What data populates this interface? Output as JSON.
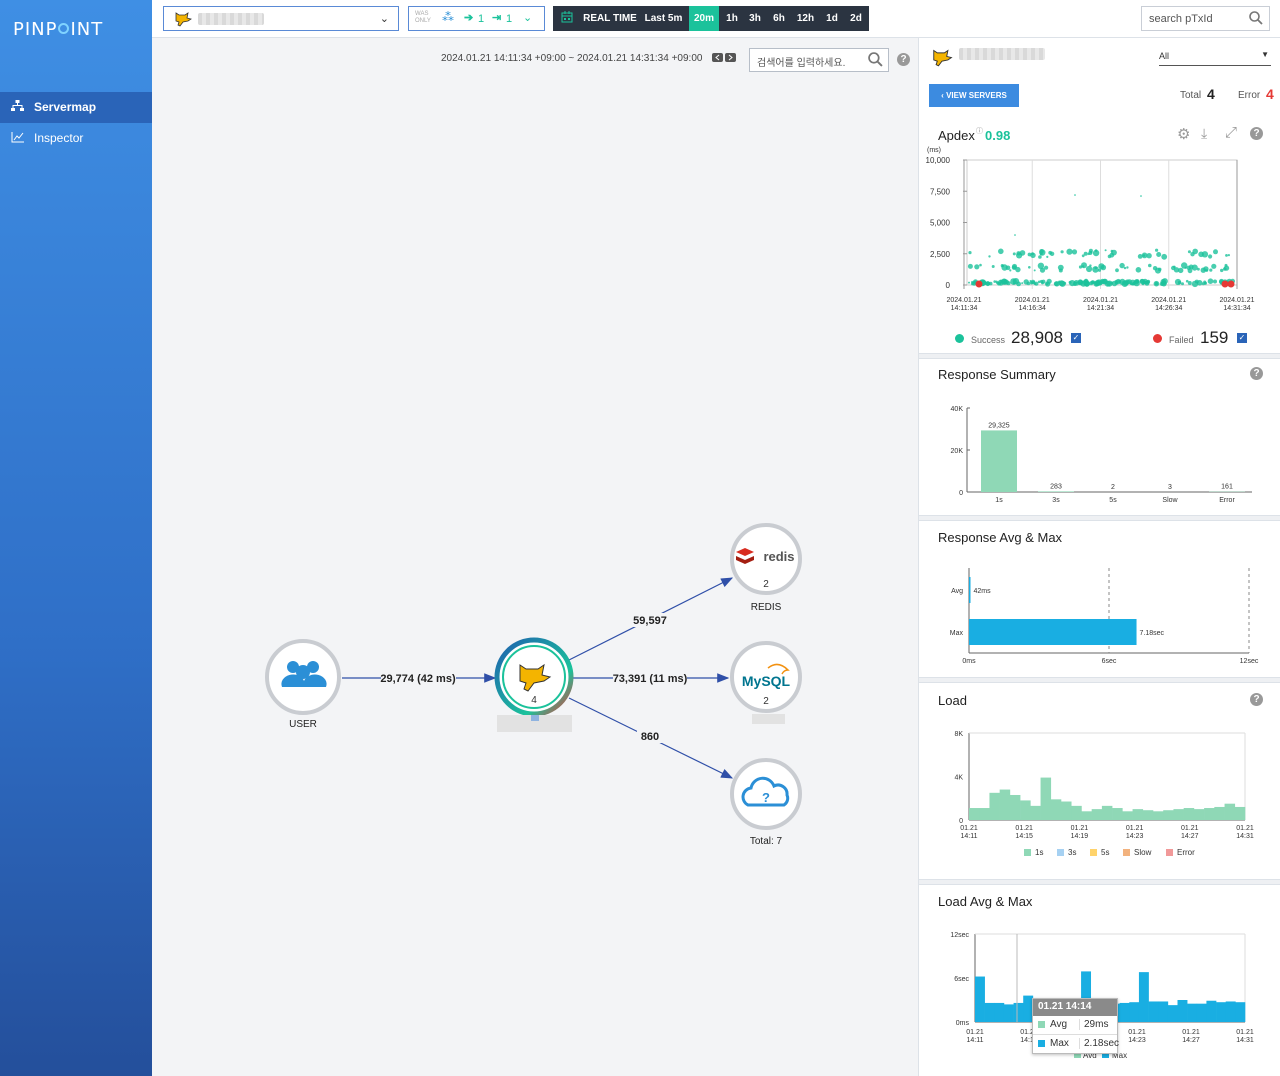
{
  "sidebar": {
    "logo": "PINPOINT",
    "items": [
      {
        "label": "Servermap",
        "icon": "servermap-icon"
      },
      {
        "label": "Inspector",
        "icon": "chart-icon"
      }
    ]
  },
  "topbar": {
    "filter": {
      "was_label": "WAS ONLY",
      "inbound": "1",
      "outbound": "1"
    },
    "time_buttons": [
      "REAL TIME",
      "Last 5m",
      "20m",
      "1h",
      "3h",
      "6h",
      "12h",
      "1d",
      "2d"
    ],
    "active_time": "20m",
    "search_placeholder": "search pTxId"
  },
  "servermap": {
    "range": "2024.01.21 14:11:34 +09:00 ~ 2024.01.21 14:31:34 +09:00",
    "search_placeholder": "검색어를 입력하세요.",
    "nodes": {
      "user": {
        "label": "USER"
      },
      "app": {
        "count": "4"
      },
      "redis": {
        "label": "REDIS",
        "count": "2",
        "logo": "redis"
      },
      "mysql": {
        "count": "2",
        "logo": "MySQL"
      },
      "unknown": {
        "label": "Total: 7"
      }
    },
    "edges": {
      "user_app": "29,774 (42 ms)",
      "app_redis": "59,597",
      "app_mysql": "73,391 (11 ms)",
      "app_unknown": "860"
    }
  },
  "panel": {
    "agent_filter": "All",
    "view_servers": "VIEW SERVERS",
    "total_label": "Total",
    "total": "4",
    "error_label": "Error",
    "error": "4",
    "apdex_label": "Apdex",
    "apdex": "0.98",
    "scatter": {
      "unit": "(ms)",
      "y_ticks": [
        "10,000",
        "7,500",
        "5,000",
        "2,500",
        "0"
      ],
      "x_ticks": [
        [
          "2024.01.21",
          "14:11:34"
        ],
        [
          "2024.01.21",
          "14:16:34"
        ],
        [
          "2024.01.21",
          "14:21:34"
        ],
        [
          "2024.01.21",
          "14:26:34"
        ],
        [
          "2024.01.21",
          "14:31:34"
        ]
      ],
      "success_label": "Success",
      "success": "28,908",
      "failed_label": "Failed",
      "failed": "159",
      "success_color": "#1bc29b",
      "failed_color": "#e53935"
    },
    "response_summary": {
      "title": "Response Summary"
    },
    "response_avg_max": {
      "title": "Response Avg & Max"
    },
    "load": {
      "title": "Load",
      "legend": [
        "1s",
        "3s",
        "5s",
        "Slow",
        "Error"
      ]
    },
    "load_avg_max": {
      "title": "Load Avg & Max",
      "tooltip": {
        "time": "01.21 14:14",
        "avg_label": "Avg",
        "avg": "29ms",
        "max_label": "Max",
        "max": "2.18sec"
      },
      "legend": [
        "Avg",
        "Max"
      ]
    }
  },
  "chart_data": [
    {
      "type": "bar",
      "title": "Response Summary",
      "categories": [
        "1s",
        "3s",
        "5s",
        "Slow",
        "Error"
      ],
      "values": [
        29325,
        283,
        2,
        3,
        161
      ],
      "y_ticks": [
        "40K",
        "20K",
        "0"
      ],
      "ylim": [
        0,
        40000
      ],
      "color": "#8fd8b6"
    },
    {
      "type": "bar",
      "title": "Response Avg & Max",
      "orientation": "horizontal",
      "categories": [
        "Avg",
        "Max"
      ],
      "values_ms": [
        42,
        7180
      ],
      "labels": [
        "42ms",
        "7.18sec"
      ],
      "x_ticks": [
        "0ms",
        "6sec",
        "12sec"
      ],
      "xlim": [
        0,
        12000
      ],
      "color": "#19aee2"
    },
    {
      "type": "bar",
      "title": "Load",
      "y_ticks": [
        "8K",
        "4K",
        "0"
      ],
      "ylim": [
        0,
        8000
      ],
      "x_ticks": [
        [
          "01.21",
          "14:11"
        ],
        [
          "01.21",
          "14:15"
        ],
        [
          "01.21",
          "14:19"
        ],
        [
          "01.21",
          "14:23"
        ],
        [
          "01.21",
          "14:27"
        ],
        [
          "01.21",
          "14:31"
        ]
      ],
      "series": [
        {
          "name": "1s",
          "color": "#8fd8b6"
        },
        {
          "name": "3s",
          "color": "#a6d1f2"
        },
        {
          "name": "5s",
          "color": "#ffd36b"
        },
        {
          "name": "Slow",
          "color": "#f2b27e"
        },
        {
          "name": "Error",
          "color": "#f19999"
        }
      ],
      "values": [
        1100,
        1100,
        2500,
        2800,
        2300,
        1800,
        1300,
        3900,
        1900,
        1700,
        1300,
        800,
        1000,
        1300,
        1100,
        800,
        1000,
        900,
        800,
        900,
        1000,
        1100,
        1000,
        1100,
        1200,
        1500,
        1200
      ]
    },
    {
      "type": "bar",
      "title": "Load Avg & Max",
      "y_ticks": [
        "12sec",
        "6sec",
        "0ms"
      ],
      "ylim": [
        0,
        12000
      ],
      "x_ticks": [
        [
          "01.21",
          "14:11"
        ],
        [
          "01.21",
          "14:15"
        ],
        [
          "01.21",
          "14:19"
        ],
        [
          "01.21",
          "14:23"
        ],
        [
          "01.21",
          "14:27"
        ],
        [
          "01.21",
          "14:31"
        ]
      ],
      "color": "#19aee2",
      "max_values_ms": [
        6200,
        2600,
        2600,
        2400,
        2600,
        3600,
        2200,
        2300,
        2100,
        2200,
        2500,
        6900,
        2500,
        2300,
        2500,
        2600,
        2700,
        6800,
        2800,
        2800,
        2300,
        3000,
        2500,
        2500,
        2900,
        2700,
        2800,
        2700
      ]
    }
  ]
}
